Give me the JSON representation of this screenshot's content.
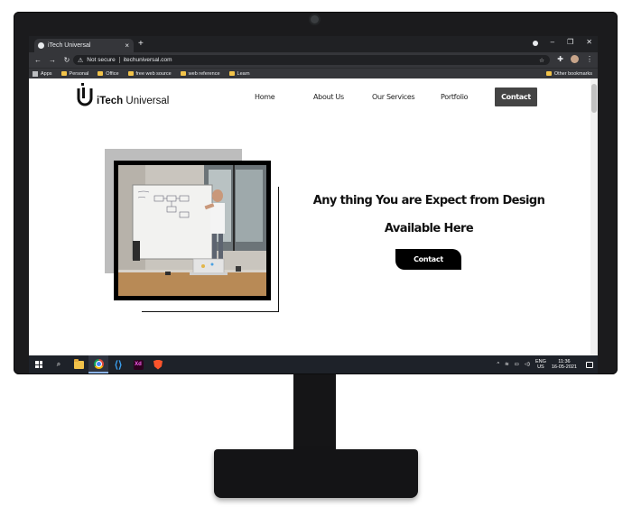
{
  "browser": {
    "tab_title": "iTech Universal",
    "tab_close": "×",
    "new_tab": "+",
    "security_label": "Not secure",
    "url": "itechuniversal.com",
    "bookmarks": [
      {
        "label": "Apps",
        "type": "apps"
      },
      {
        "label": "Personal",
        "type": "folder"
      },
      {
        "label": "Office",
        "type": "folder"
      },
      {
        "label": "free web source",
        "type": "folder"
      },
      {
        "label": "web reference",
        "type": "folder"
      },
      {
        "label": "Learn",
        "type": "folder"
      }
    ],
    "other_bookmarks": "Other bookmarks"
  },
  "site": {
    "logo_bold": "iTech",
    "logo_thin": "Universal",
    "nav": [
      "Home",
      "About Us",
      "Our Services",
      "Portfolio"
    ],
    "nav_contact": "Contact",
    "hero_line1": "Any thing You are Expect from Design",
    "hero_line2": "Available Here",
    "hero_button": "Contact"
  },
  "taskbar": {
    "lang_top": "ENG",
    "lang_bottom": "US",
    "time": "11:36",
    "date": "16-05-2021"
  },
  "colors": {
    "chrome_dark": "#202124",
    "chrome_toolbar": "#35363a",
    "nav_contact_bg": "#444444",
    "hero_button_bg": "#000000",
    "taskbar_bg": "#1e2229",
    "monitor_bezel": "#1b1b1d"
  }
}
